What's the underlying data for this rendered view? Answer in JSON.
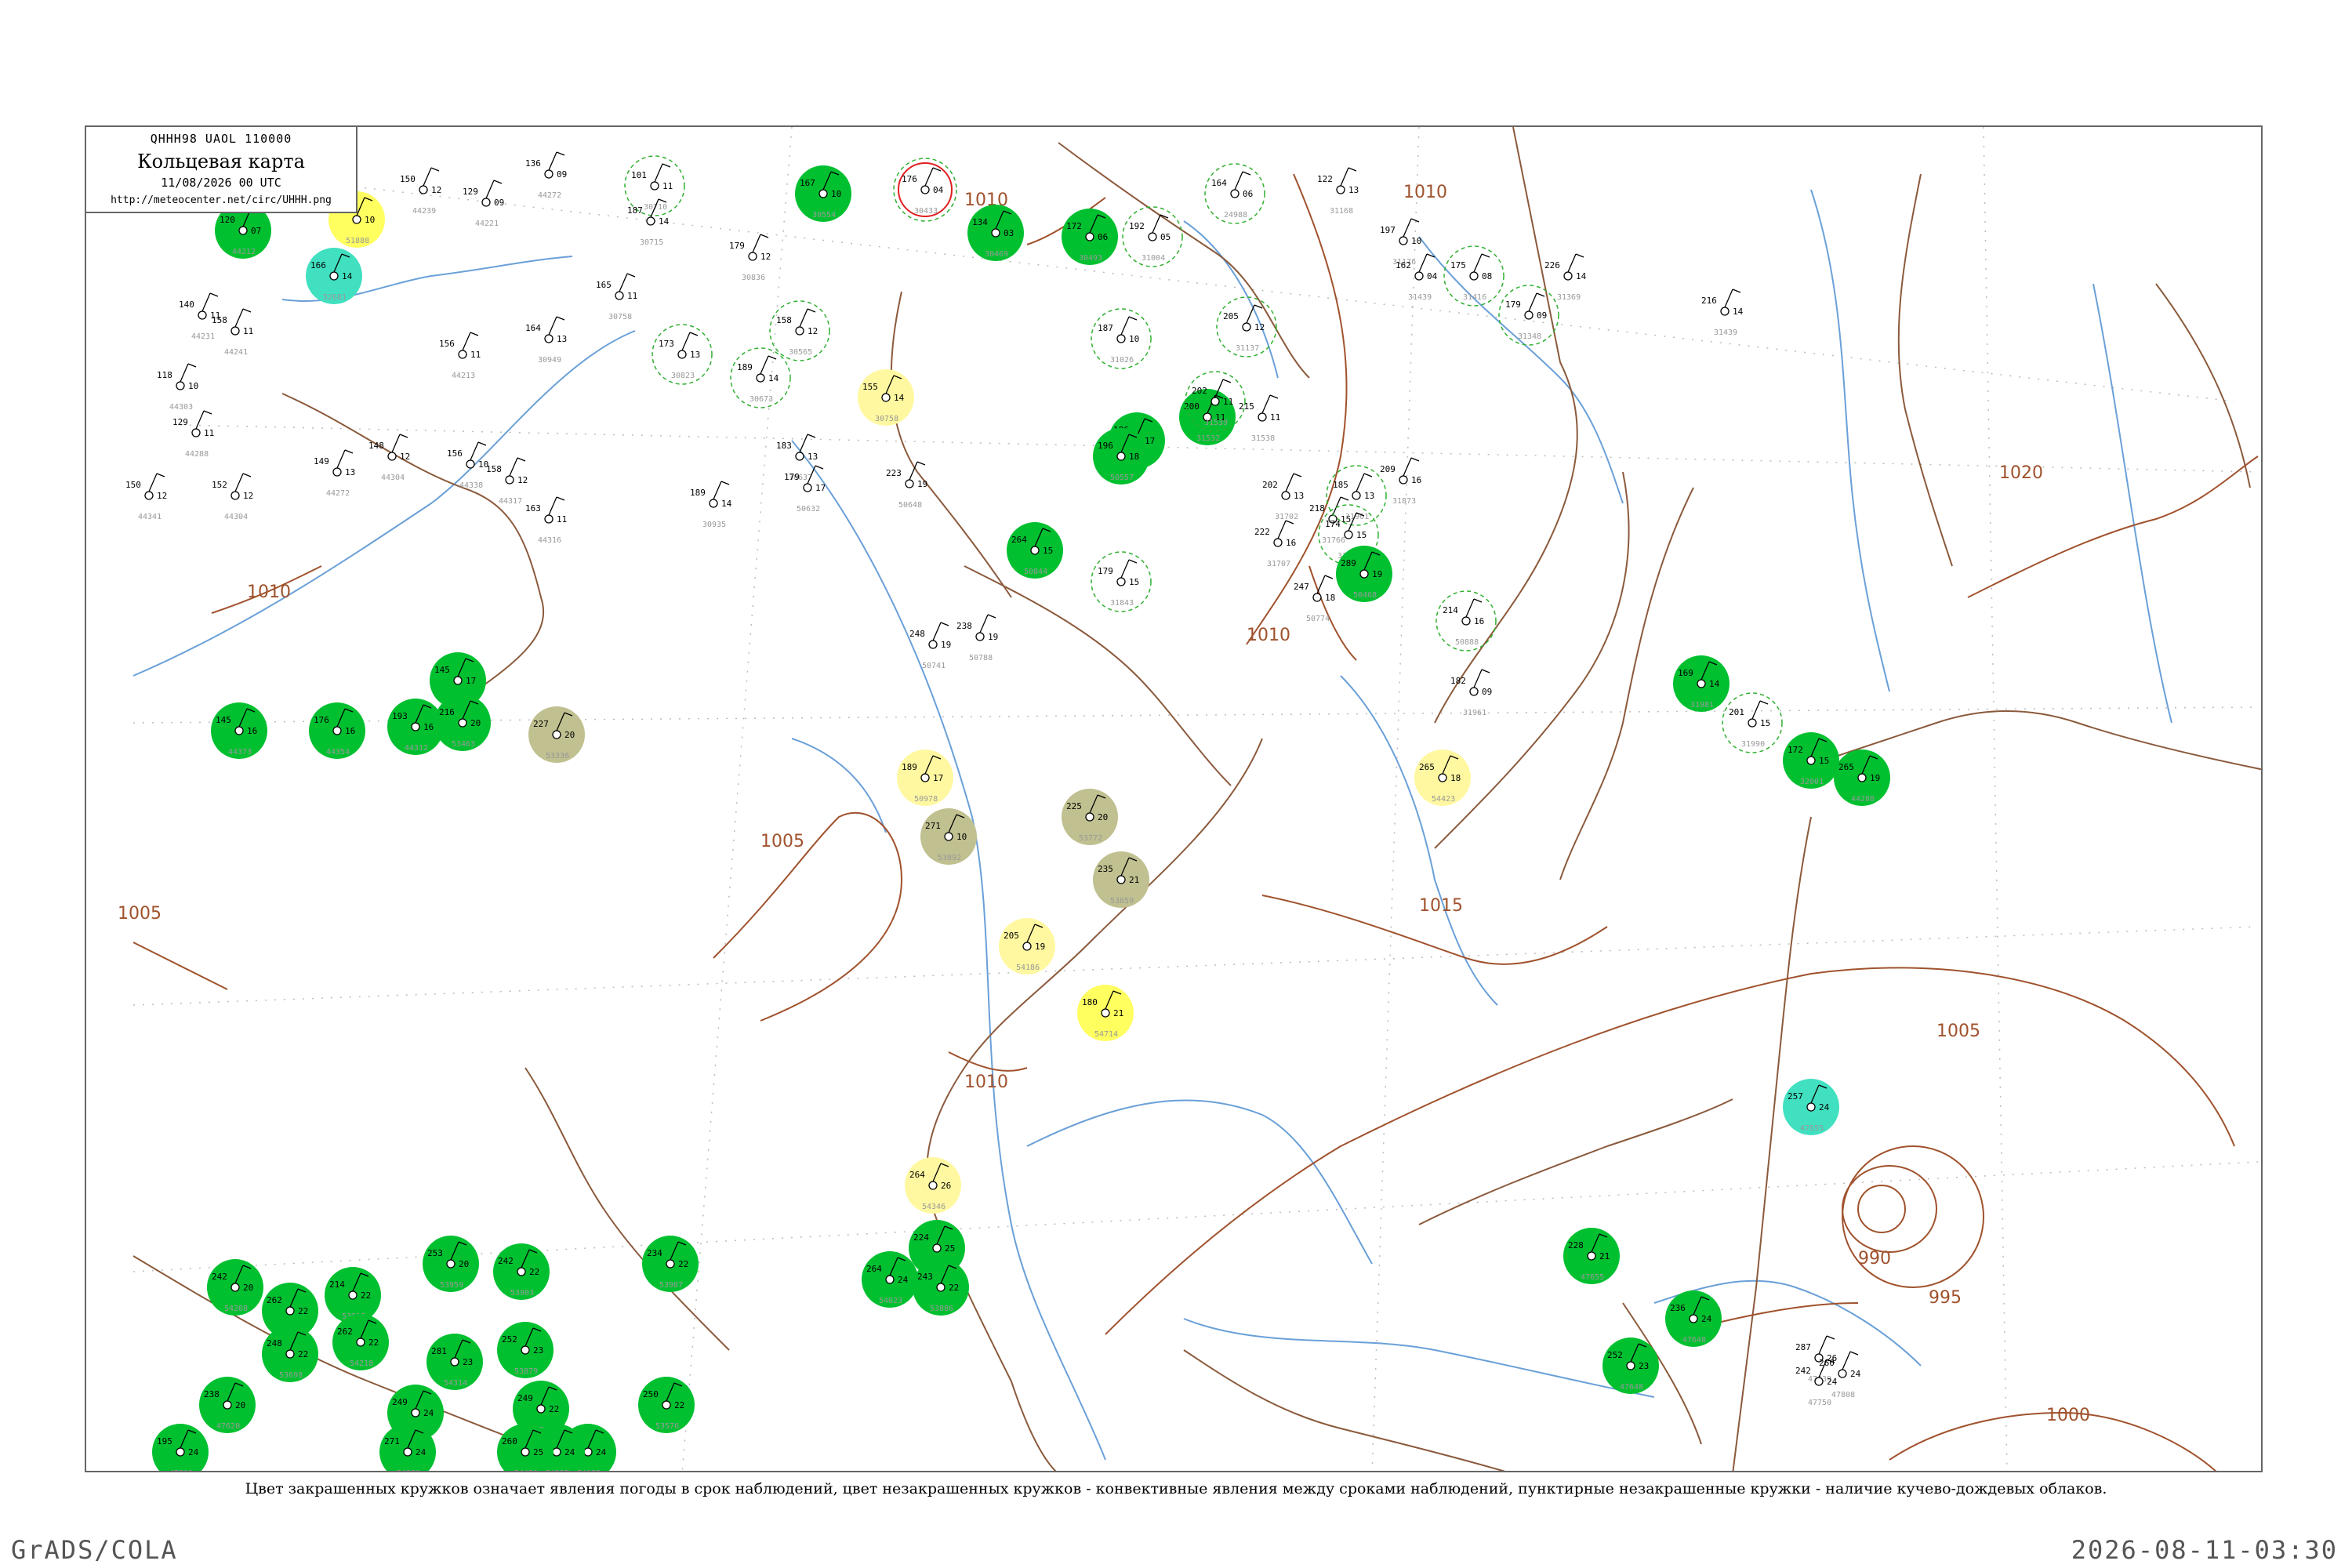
{
  "header": {
    "code": "QHHH98  UAOL  110000",
    "title": "Кольцевая карта",
    "datetime": "11/08/2026 00 UTC",
    "url": "http://meteocenter.net/circ/UHHH.png"
  },
  "footer": {
    "note": "Цвет закрашенных кружков означает явления погоды в срок наблюдений, цвет незакрашенных кружков - конвективные явления между сроками наблюдений, пунктирные незакрашенные кружки - наличие кучево-дождевых облаков.",
    "credit": "GrADS/COLA",
    "stamp": "2026-08-11-03:30"
  },
  "colors": {
    "rain": "#00c030",
    "drizzle": "#40e0c0",
    "fog": "#ffff60",
    "haze": "#fff8a0",
    "dust": "#c0c090",
    "thunder": "#e02020",
    "isobar": "#a0522d",
    "river": "#6aa0d8",
    "cb_dashed": "#30b030"
  },
  "isobars": [
    {
      "label": "1010"
    },
    {
      "label": "1010"
    },
    {
      "label": "1010"
    },
    {
      "label": "1010"
    },
    {
      "label": "1015"
    },
    {
      "label": "1020"
    },
    {
      "label": "1005"
    },
    {
      "label": "1005"
    },
    {
      "label": "1005"
    },
    {
      "label": "1000"
    },
    {
      "label": "1000"
    },
    {
      "label": "995"
    },
    {
      "label": "990"
    },
    {
      "label": "1010"
    },
    {
      "label": "1010"
    }
  ],
  "stations": [
    {
      "p": "159",
      "t": "10",
      "i": "51888",
      "kind": "fog"
    },
    {
      "p": "166",
      "t": "14",
      "i": "52681",
      "kind": "drizzle"
    },
    {
      "p": "120",
      "t": "07",
      "i": "44212",
      "kind": "rain"
    },
    {
      "p": "150",
      "t": "12",
      "i": "44239",
      "kind": "none"
    },
    {
      "p": "129",
      "t": "09",
      "i": "44221",
      "kind": "none"
    },
    {
      "p": "136",
      "t": "09",
      "i": "44272",
      "kind": "none"
    },
    {
      "p": "101",
      "t": "11",
      "i": "30710",
      "kind": "cb"
    },
    {
      "p": "187",
      "t": "14",
      "i": "30715",
      "kind": "none"
    },
    {
      "p": "179",
      "t": "12",
      "i": "30836",
      "kind": "none"
    },
    {
      "p": "167",
      "t": "10",
      "i": "30554",
      "kind": "rain"
    },
    {
      "p": "176",
      "t": "04",
      "i": "30433",
      "kind": "thunder"
    },
    {
      "p": "134",
      "t": "03",
      "i": "30469",
      "kind": "rain"
    },
    {
      "p": "172",
      "t": "06",
      "i": "30493",
      "kind": "rain"
    },
    {
      "p": "192",
      "t": "05",
      "i": "31004",
      "kind": "cb"
    },
    {
      "p": "164",
      "t": "06",
      "i": "24988",
      "kind": "cb"
    },
    {
      "p": "122",
      "t": "13",
      "i": "31168",
      "kind": "none"
    },
    {
      "p": "197",
      "t": "10",
      "i": "31176",
      "kind": "none"
    },
    {
      "p": "226",
      "t": "14",
      "i": "31369",
      "kind": "none"
    },
    {
      "p": "140",
      "t": "11",
      "i": "44231",
      "kind": "none"
    },
    {
      "p": "158",
      "t": "11",
      "i": "44241",
      "kind": "none"
    },
    {
      "p": "156",
      "t": "11",
      "i": "44213",
      "kind": "none"
    },
    {
      "p": "164",
      "t": "13",
      "i": "30949",
      "kind": "none"
    },
    {
      "p": "165",
      "t": "11",
      "i": "30758",
      "kind": "none"
    },
    {
      "p": "173",
      "t": "13",
      "i": "30823",
      "kind": "cb"
    },
    {
      "p": "158",
      "t": "12",
      "i": "30565",
      "kind": "cb"
    },
    {
      "p": "189",
      "t": "14",
      "i": "30673",
      "kind": "cb"
    },
    {
      "p": "155",
      "t": "14",
      "i": "30758",
      "kind": "haze"
    },
    {
      "p": "187",
      "t": "10",
      "i": "31026",
      "kind": "cb"
    },
    {
      "p": "205",
      "t": "12",
      "i": "31137",
      "kind": "cb"
    },
    {
      "p": "162",
      "t": "04",
      "i": "31439",
      "kind": "none"
    },
    {
      "p": "175",
      "t": "08",
      "i": "31416",
      "kind": "cb"
    },
    {
      "p": "179",
      "t": "09",
      "i": "31348",
      "kind": "cb"
    },
    {
      "p": "216",
      "t": "14",
      "i": "31439",
      "kind": "none"
    },
    {
      "p": "118",
      "t": "10",
      "i": "44303",
      "kind": "none"
    },
    {
      "p": "129",
      "t": "11",
      "i": "44288",
      "kind": "none"
    },
    {
      "p": "150",
      "t": "12",
      "i": "44341",
      "kind": "none"
    },
    {
      "p": "152",
      "t": "12",
      "i": "44304",
      "kind": "none"
    },
    {
      "p": "149",
      "t": "13",
      "i": "44272",
      "kind": "none"
    },
    {
      "p": "148",
      "t": "12",
      "i": "44304",
      "kind": "none"
    },
    {
      "p": "156",
      "t": "10",
      "i": "44338",
      "kind": "none"
    },
    {
      "p": "158",
      "t": "12",
      "i": "44317",
      "kind": "none"
    },
    {
      "p": "163",
      "t": "11",
      "i": "44316",
      "kind": "none"
    },
    {
      "p": "189",
      "t": "14",
      "i": "30935",
      "kind": "none"
    },
    {
      "p": "183",
      "t": "13",
      "i": "30637",
      "kind": "none"
    },
    {
      "p": "179",
      "t": "17",
      "i": "50632",
      "kind": "none"
    },
    {
      "p": "223",
      "t": "19",
      "i": "50648",
      "kind": "none"
    },
    {
      "p": "186",
      "t": "17",
      "i": "50564",
      "kind": "rain"
    },
    {
      "p": "196",
      "t": "18",
      "i": "50557",
      "kind": "rain"
    },
    {
      "p": "200",
      "t": "11",
      "i": "31532",
      "kind": "rain"
    },
    {
      "p": "202",
      "t": "11",
      "i": "31539",
      "kind": "cb"
    },
    {
      "p": "215",
      "t": "11",
      "i": "31538",
      "kind": "none"
    },
    {
      "p": "202",
      "t": "13",
      "i": "31702",
      "kind": "none"
    },
    {
      "p": "222",
      "t": "16",
      "i": "31707",
      "kind": "none"
    },
    {
      "p": "218",
      "t": "15",
      "i": "31766",
      "kind": "none"
    },
    {
      "p": "209",
      "t": "16",
      "i": "31873",
      "kind": "none"
    },
    {
      "p": "185",
      "t": "13",
      "i": "31961",
      "kind": "cb"
    },
    {
      "p": "174",
      "t": "15",
      "i": "31960",
      "kind": "cb"
    },
    {
      "p": "179",
      "t": "15",
      "i": "31843",
      "kind": "cb"
    },
    {
      "p": "247",
      "t": "18",
      "i": "50774",
      "kind": "none"
    },
    {
      "p": "214",
      "t": "16",
      "i": "50888",
      "kind": "cb"
    },
    {
      "p": "238",
      "t": "19",
      "i": "50788",
      "kind": "none"
    },
    {
      "p": "248",
      "t": "19",
      "i": "50741",
      "kind": "none"
    },
    {
      "p": "264",
      "t": "15",
      "i": "50844",
      "kind": "rain"
    },
    {
      "p": "289",
      "t": "19",
      "i": "50468",
      "kind": "rain"
    },
    {
      "p": "182",
      "t": "09",
      "i": "31961",
      "kind": "none"
    },
    {
      "p": "169",
      "t": "14",
      "i": "31981",
      "kind": "rain"
    },
    {
      "p": "201",
      "t": "15",
      "i": "31990",
      "kind": "cb"
    },
    {
      "p": "172",
      "t": "15",
      "i": "32001",
      "kind": "rain"
    },
    {
      "p": "265",
      "t": "19",
      "i": "44288",
      "kind": "rain"
    },
    {
      "p": "145",
      "t": "16",
      "i": "44373",
      "kind": "rain"
    },
    {
      "p": "176",
      "t": "16",
      "i": "44354",
      "kind": "rain"
    },
    {
      "p": "145",
      "t": "17",
      "i": "44354",
      "kind": "rain"
    },
    {
      "p": "193",
      "t": "16",
      "i": "44312",
      "kind": "rain"
    },
    {
      "p": "216",
      "t": "20",
      "i": "53463",
      "kind": "rain"
    },
    {
      "p": "227",
      "t": "20",
      "i": "53336",
      "kind": "dust"
    },
    {
      "p": "271",
      "t": "10",
      "i": "53892",
      "kind": "dust"
    },
    {
      "p": "225",
      "t": "20",
      "i": "53772",
      "kind": "dust"
    },
    {
      "p": "235",
      "t": "21",
      "i": "53859",
      "kind": "dust"
    },
    {
      "p": "265",
      "t": "18",
      "i": "54423",
      "kind": "haze"
    },
    {
      "p": "205",
      "t": "19",
      "i": "54186",
      "kind": "haze"
    },
    {
      "p": "189",
      "t": "17",
      "i": "50978",
      "kind": "haze"
    },
    {
      "p": "180",
      "t": "21",
      "i": "54714",
      "kind": "fog"
    },
    {
      "p": "264",
      "t": "26",
      "i": "54346",
      "kind": "haze"
    },
    {
      "p": "224",
      "t": "25",
      "i": "53798",
      "kind": "rain"
    },
    {
      "p": "243",
      "t": "22",
      "i": "53886",
      "kind": "rain"
    },
    {
      "p": "264",
      "t": "24",
      "i": "54023",
      "kind": "rain"
    },
    {
      "p": "234",
      "t": "22",
      "i": "53987",
      "kind": "rain"
    },
    {
      "p": "242",
      "t": "22",
      "i": "53903",
      "kind": "rain"
    },
    {
      "p": "253",
      "t": "20",
      "i": "53959",
      "kind": "rain"
    },
    {
      "p": "214",
      "t": "22",
      "i": "53915",
      "kind": "rain"
    },
    {
      "p": "262",
      "t": "22",
      "i": "54102",
      "kind": "rain"
    },
    {
      "p": "242",
      "t": "20",
      "i": "54208",
      "kind": "rain"
    },
    {
      "p": "248",
      "t": "22",
      "i": "53698",
      "kind": "rain"
    },
    {
      "p": "262",
      "t": "22",
      "i": "54218",
      "kind": "rain"
    },
    {
      "p": "281",
      "t": "23",
      "i": "54314",
      "kind": "rain"
    },
    {
      "p": "252",
      "t": "23",
      "i": "53879",
      "kind": "rain"
    },
    {
      "p": "250",
      "t": "22",
      "i": "53576",
      "kind": "rain"
    },
    {
      "p": "249",
      "t": "22",
      "i": "53776",
      "kind": "rain"
    },
    {
      "p": "262",
      "t": "24",
      "i": "54135",
      "kind": "rain"
    },
    {
      "p": "281",
      "t": "24",
      "i": "54527",
      "kind": "rain"
    },
    {
      "p": "249",
      "t": "24",
      "i": "54324",
      "kind": "rain"
    },
    {
      "p": "260",
      "t": "25",
      "i": "54423",
      "kind": "rain"
    },
    {
      "p": "271",
      "t": "24",
      "i": "54559",
      "kind": "rain"
    },
    {
      "p": "195",
      "t": "24",
      "i": "47508",
      "kind": "rain"
    },
    {
      "p": "238",
      "t": "20",
      "i": "47620",
      "kind": "rain"
    },
    {
      "p": "257",
      "t": "24",
      "i": "47655",
      "kind": "drizzle"
    },
    {
      "p": "228",
      "t": "21",
      "i": "47655",
      "kind": "rain"
    },
    {
      "p": "236",
      "t": "24",
      "i": "47648",
      "kind": "rain"
    },
    {
      "p": "252",
      "t": "23",
      "i": "47648",
      "kind": "rain"
    },
    {
      "p": "287",
      "t": "26",
      "i": "47639",
      "kind": "none"
    },
    {
      "p": "242",
      "t": "24",
      "i": "47750",
      "kind": "none"
    },
    {
      "p": "260",
      "t": "24",
      "i": "47808",
      "kind": "none"
    }
  ]
}
